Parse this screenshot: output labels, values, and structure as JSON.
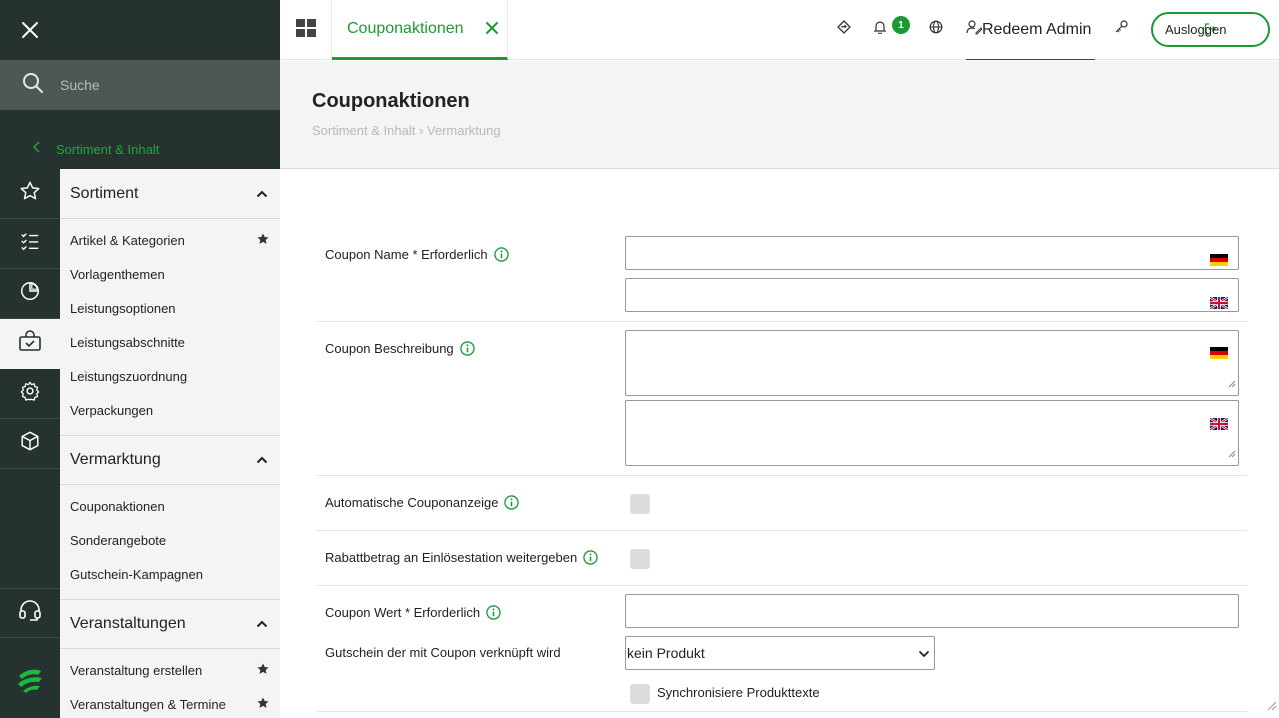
{
  "sidebar": {
    "search_placeholder": "Suche",
    "back_label": "Sortiment & Inhalt",
    "rail_icons": [
      "star-icon",
      "checklist-icon",
      "pie-chart-icon",
      "bag-icon",
      "gear-icon",
      "cube-icon"
    ],
    "rail_active_index": 3,
    "groups": [
      {
        "title": "Sortiment",
        "items": [
          {
            "label": "Artikel & Kategorien",
            "starred": true
          },
          {
            "label": "Vorlagenthemen",
            "starred": false
          },
          {
            "label": "Leistungsoptionen",
            "starred": false
          },
          {
            "label": "Leistungsabschnitte",
            "starred": false
          },
          {
            "label": "Leistungszuordnung",
            "starred": false
          },
          {
            "label": "Verpackungen",
            "starred": false
          }
        ]
      },
      {
        "title": "Vermarktung",
        "items": [
          {
            "label": "Couponaktionen",
            "starred": false
          },
          {
            "label": "Sonderangebote",
            "starred": false
          },
          {
            "label": "Gutschein-Kampagnen",
            "starred": false
          }
        ]
      },
      {
        "title": "Veranstaltungen",
        "items": [
          {
            "label": "Veranstaltung erstellen",
            "starred": true
          },
          {
            "label": "Veranstaltungen & Termine",
            "starred": true
          }
        ]
      }
    ]
  },
  "topbar": {
    "tab_label": "Couponaktionen",
    "notification_count": "1",
    "user_name": "Redeem Admin",
    "logout_label": "Ausloggen"
  },
  "page": {
    "title": "Couponaktionen",
    "breadcrumb": "Sortiment & Inhalt › Vermarktung"
  },
  "form": {
    "coupon_name_label": "Coupon Name * Erforderlich",
    "coupon_description_label": "Coupon Beschreibung",
    "auto_display_label": "Automatische Couponanzeige",
    "pass_discount_label": "Rabattbetrag an Einlösestation weitergeben",
    "coupon_value_label": "Coupon Wert * Erforderlich",
    "linked_voucher_label": "Gutschein der mit Coupon verknüpft wird",
    "linked_voucher_value": "kein Produkt",
    "sync_texts_label": "Synchronisiere Produkttexte"
  },
  "colors": {
    "accent": "#1b9a34",
    "sidebar_dark": "#253230",
    "sidebar_light": "#f4f4f4"
  }
}
